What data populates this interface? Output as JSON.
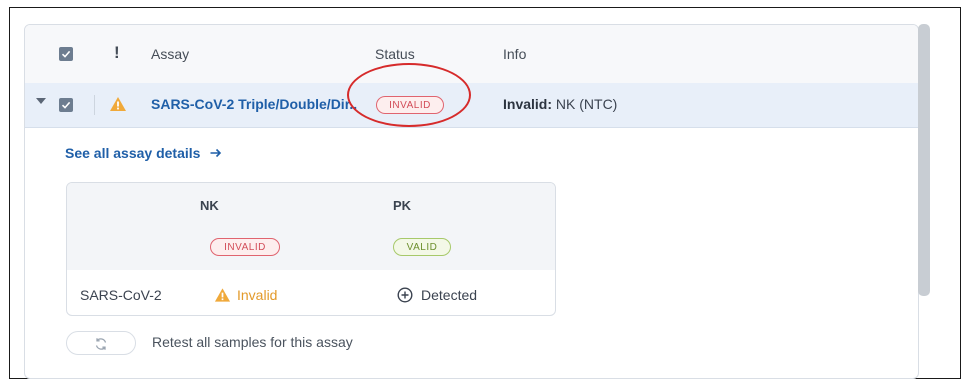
{
  "table": {
    "header": {
      "assay": "Assay",
      "status": "Status",
      "info": "Info",
      "priority_symbol": "!"
    },
    "row": {
      "assay_name": "SARS-CoV-2 Triple/Double/Dir..",
      "status_badge": "INVALID",
      "info_label": "Invalid:",
      "info_value": " NK (NTC)"
    }
  },
  "details": {
    "see_all_link": "See all assay details",
    "columns": [
      {
        "name": "NK",
        "badge": "INVALID"
      },
      {
        "name": "PK",
        "badge": "VALID"
      }
    ],
    "target": {
      "name": "SARS-CoV-2",
      "nk_result": "Invalid",
      "pk_result": "Detected"
    },
    "retest_label": "Retest all samples for this assay"
  },
  "colors": {
    "link": "#1f5fa8",
    "invalid": "#d24c58",
    "valid": "#6c8f2d",
    "warning": "#f0a93a",
    "row_highlight": "#e8eff9",
    "annotation": "#d62b2b"
  }
}
